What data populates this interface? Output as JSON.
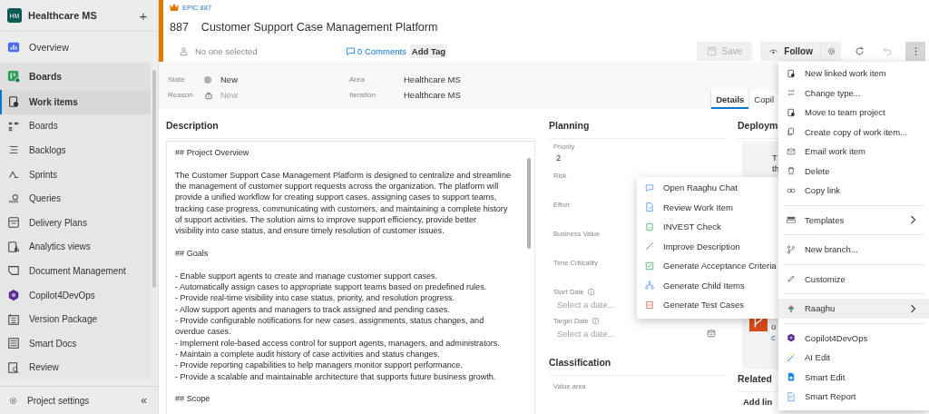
{
  "sidebar": {
    "initials": "HM",
    "title": "Healthcare MS",
    "add_label": "+",
    "items": [
      {
        "kind": "hub",
        "label": "Overview",
        "expanded": false,
        "selected": false
      },
      {
        "kind": "hub",
        "label": "Boards",
        "expanded": true,
        "selected": false
      },
      {
        "kind": "sub",
        "label": "Work items",
        "selected": true
      },
      {
        "kind": "sub",
        "label": "Boards",
        "selected": false
      },
      {
        "kind": "sub",
        "label": "Backlogs",
        "selected": false
      },
      {
        "kind": "sub",
        "label": "Sprints",
        "selected": false
      },
      {
        "kind": "sub",
        "label": "Queries",
        "selected": false
      },
      {
        "kind": "sub",
        "label": "Delivery Plans",
        "selected": false
      },
      {
        "kind": "sub",
        "label": "Analytics views",
        "selected": false
      },
      {
        "kind": "sub",
        "label": "Document Management",
        "selected": false
      },
      {
        "kind": "sub",
        "label": "Copilot4DevOps",
        "selected": false
      },
      {
        "kind": "sub",
        "label": "Version Package",
        "selected": false
      },
      {
        "kind": "sub",
        "label": "Smart Docs",
        "selected": false
      },
      {
        "kind": "sub",
        "label": "Review",
        "selected": false
      }
    ],
    "footer": {
      "label": "Project settings",
      "collapse": "«"
    }
  },
  "work_item": {
    "type_label": "EPIC 887",
    "id": "887",
    "title": "Customer Support Case Management Platform",
    "assignee_placeholder": "No one selected",
    "comments": "0 Comments",
    "add_tag": "Add Tag",
    "toolbar": {
      "save": {
        "label": "Save",
        "disabled": true
      },
      "follow": {
        "label": "Follow"
      },
      "undo": {
        "disabled": true
      },
      "more": {
        "pressed": true
      }
    },
    "fields": [
      {
        "label": "State",
        "value": "New",
        "muted": false
      },
      {
        "label": "Reason",
        "value": "New",
        "muted": true
      }
    ],
    "fields_right": [
      {
        "label": "Area",
        "value": "Healthcare MS"
      },
      {
        "label": "Iteration",
        "value": "Healthcare MS"
      }
    ],
    "tabs": [
      {
        "label": "Details",
        "selected": true
      },
      {
        "label": "Copil",
        "selected": false
      }
    ]
  },
  "description": {
    "title": "Description",
    "blocks": [
      {
        "kind": "heading",
        "lines": [
          "## Project Overview"
        ]
      },
      {
        "kind": "paragraph",
        "lines": [
          "The Customer Support Case Management Platform is designed to centralize and streamline",
          "the management of customer support requests across the organization. The platform will",
          "provide a unified workflow for creating support cases, assigning cases to support teams,",
          "tracking case progress, communicating with customers, and maintaining a complete history",
          "of support activities. The solution aims to improve support efficiency, provide better",
          "visibility into case status, and ensure timely resolution of customer issues."
        ]
      },
      {
        "kind": "heading",
        "lines": [
          "## Goals"
        ]
      },
      {
        "kind": "bullet",
        "lines": [
          "- Enable support agents to create and manage customer support cases."
        ]
      },
      {
        "kind": "bullet",
        "lines": [
          "- Automatically assign cases to appropriate support teams based on predefined rules."
        ]
      },
      {
        "kind": "bullet",
        "lines": [
          "- Provide real-time visibility into case status, priority, and resolution progress."
        ]
      },
      {
        "kind": "bullet",
        "lines": [
          "- Allow support agents and managers to track assigned and pending cases."
        ]
      },
      {
        "kind": "bullet",
        "lines": [
          "- Provide configurable notifications for new cases, assignments, status changes, and",
          "overdue cases."
        ]
      },
      {
        "kind": "bullet",
        "lines": [
          "- Implement role-based access control for support agents, managers, and administrators."
        ]
      },
      {
        "kind": "bullet",
        "lines": [
          "- Maintain a complete audit history of case activities and status changes."
        ]
      },
      {
        "kind": "bullet",
        "lines": [
          "- Provide reporting capabilities to help managers monitor support performance."
        ]
      },
      {
        "kind": "bullet",
        "lines": [
          "- Provide a scalable and maintainable architecture that supports future business growth."
        ]
      },
      {
        "kind": "heading",
        "lines": [
          "## Scope"
        ]
      }
    ]
  },
  "planning": {
    "title": "Planning",
    "fields": [
      {
        "kind": "text",
        "label": "Priority",
        "value": "2"
      },
      {
        "kind": "text",
        "label": "Risk"
      },
      {
        "kind": "text",
        "label": "Effort"
      },
      {
        "kind": "text",
        "label": "Business Value"
      },
      {
        "kind": "text",
        "label": "Time Criticality"
      },
      {
        "kind": "date",
        "label": "Start Date",
        "placeholder": "Select a date..."
      },
      {
        "kind": "date",
        "label": "Target Date",
        "placeholder": "Select a date..."
      }
    ],
    "classification_title": "Classification",
    "value_area_label": "Value area"
  },
  "deployment": {
    "title": "Deploym",
    "card_lines": [
      "T",
      "th"
    ],
    "card2_lines": [
      "o",
      "c"
    ],
    "related_title": "Related",
    "add_link": "Add lin"
  },
  "context_menu": {
    "items": [
      {
        "kind": "item",
        "label": "New linked work item"
      },
      {
        "kind": "item",
        "label": "Change type..."
      },
      {
        "kind": "item",
        "label": "Move to team project"
      },
      {
        "kind": "item",
        "label": "Create copy of work item..."
      },
      {
        "kind": "item",
        "label": "Email work item"
      },
      {
        "kind": "item",
        "label": "Delete"
      },
      {
        "kind": "item",
        "label": "Copy link"
      },
      {
        "kind": "separator"
      },
      {
        "kind": "submenu",
        "label": "Templates",
        "expanded": false
      },
      {
        "kind": "separator"
      },
      {
        "kind": "item",
        "label": "New branch..."
      },
      {
        "kind": "separator"
      },
      {
        "kind": "item",
        "label": "Customize"
      },
      {
        "kind": "separator"
      },
      {
        "kind": "submenu",
        "label": "Raaghu",
        "expanded": true
      },
      {
        "kind": "separator"
      },
      {
        "kind": "item",
        "label": "Copilot4DevOps"
      },
      {
        "kind": "item",
        "label": "AI Edit"
      },
      {
        "kind": "item",
        "label": "Smart Edit"
      },
      {
        "kind": "item",
        "label": "Smart Report"
      }
    ]
  },
  "submenu": {
    "items": [
      {
        "label": "Open Raaghu Chat"
      },
      {
        "label": "Review Work Item"
      },
      {
        "label": "INVEST Check"
      },
      {
        "label": "Improve Description"
      },
      {
        "label": "Generate Acceptance Criteria"
      },
      {
        "label": "Generate Child Items"
      },
      {
        "label": "Generate Test Cases"
      }
    ]
  }
}
